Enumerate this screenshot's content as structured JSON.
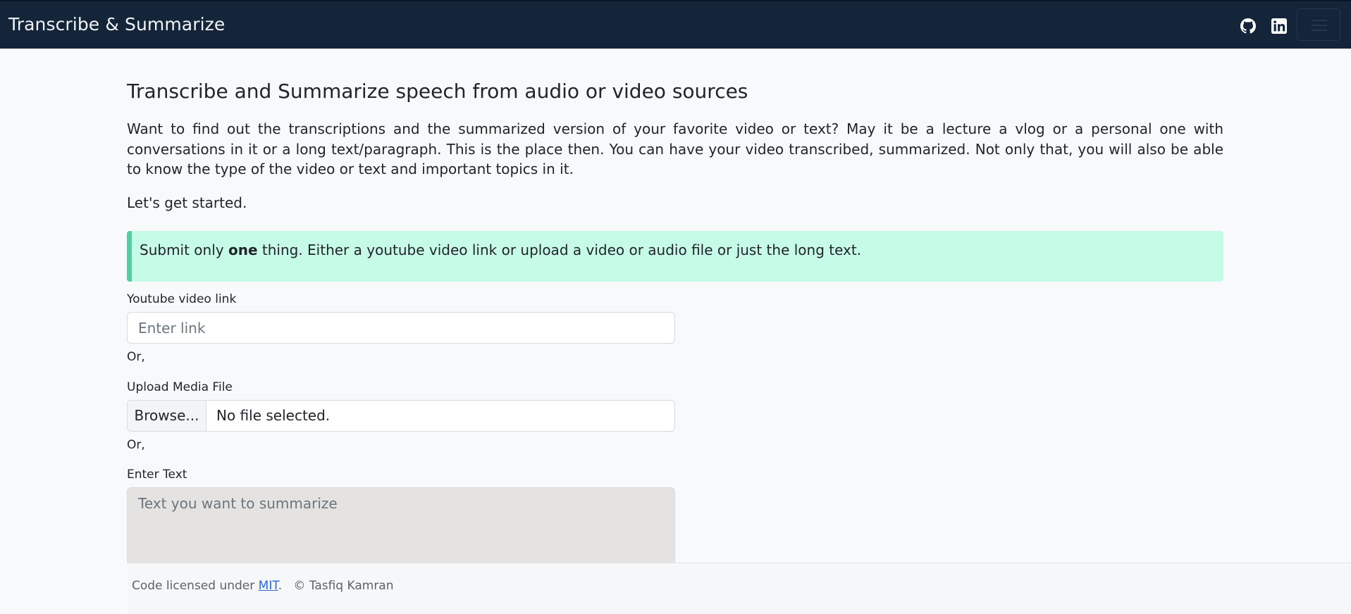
{
  "navbar": {
    "brand": "Transcribe & Summarize",
    "icons": [
      "github-icon",
      "linkedin-icon",
      "menu-icon"
    ],
    "background": "#14253a"
  },
  "main": {
    "heading": "Transcribe and Summarize speech from audio or video sources",
    "intro": "Want to find out the transcriptions and the summarized version of your favorite video or text? May it be a lecture a vlog or a personal one with conversations in it or a long text/paragraph. This is the place then. You can have your video transcribed, summarized. Not only that, you will also be able to know the type of the video or text and important topics in it.",
    "started": "Let's get started.",
    "alert": {
      "prefix": "Submit only ",
      "bold": "one",
      "suffix": " thing. Either a youtube video link or upload a video or audio file or just the long text.",
      "background": "#c6fbe8",
      "accent": "#4fd1a5"
    }
  },
  "form": {
    "youtube_label": "Youtube video link",
    "youtube_placeholder": "Enter link",
    "or_1": "Or,",
    "upload_label": "Upload Media File",
    "browse_label": "Browse...",
    "file_status": "No file selected.",
    "or_2": "Or,",
    "text_label": "Enter Text",
    "text_placeholder": "Text you want to summarize"
  },
  "footer": {
    "prefix": "Code licensed under ",
    "license_link": "MIT",
    "suffix": ".",
    "copyright": "© Tasfiq Kamran",
    "link_color": "#2a6ad6"
  }
}
